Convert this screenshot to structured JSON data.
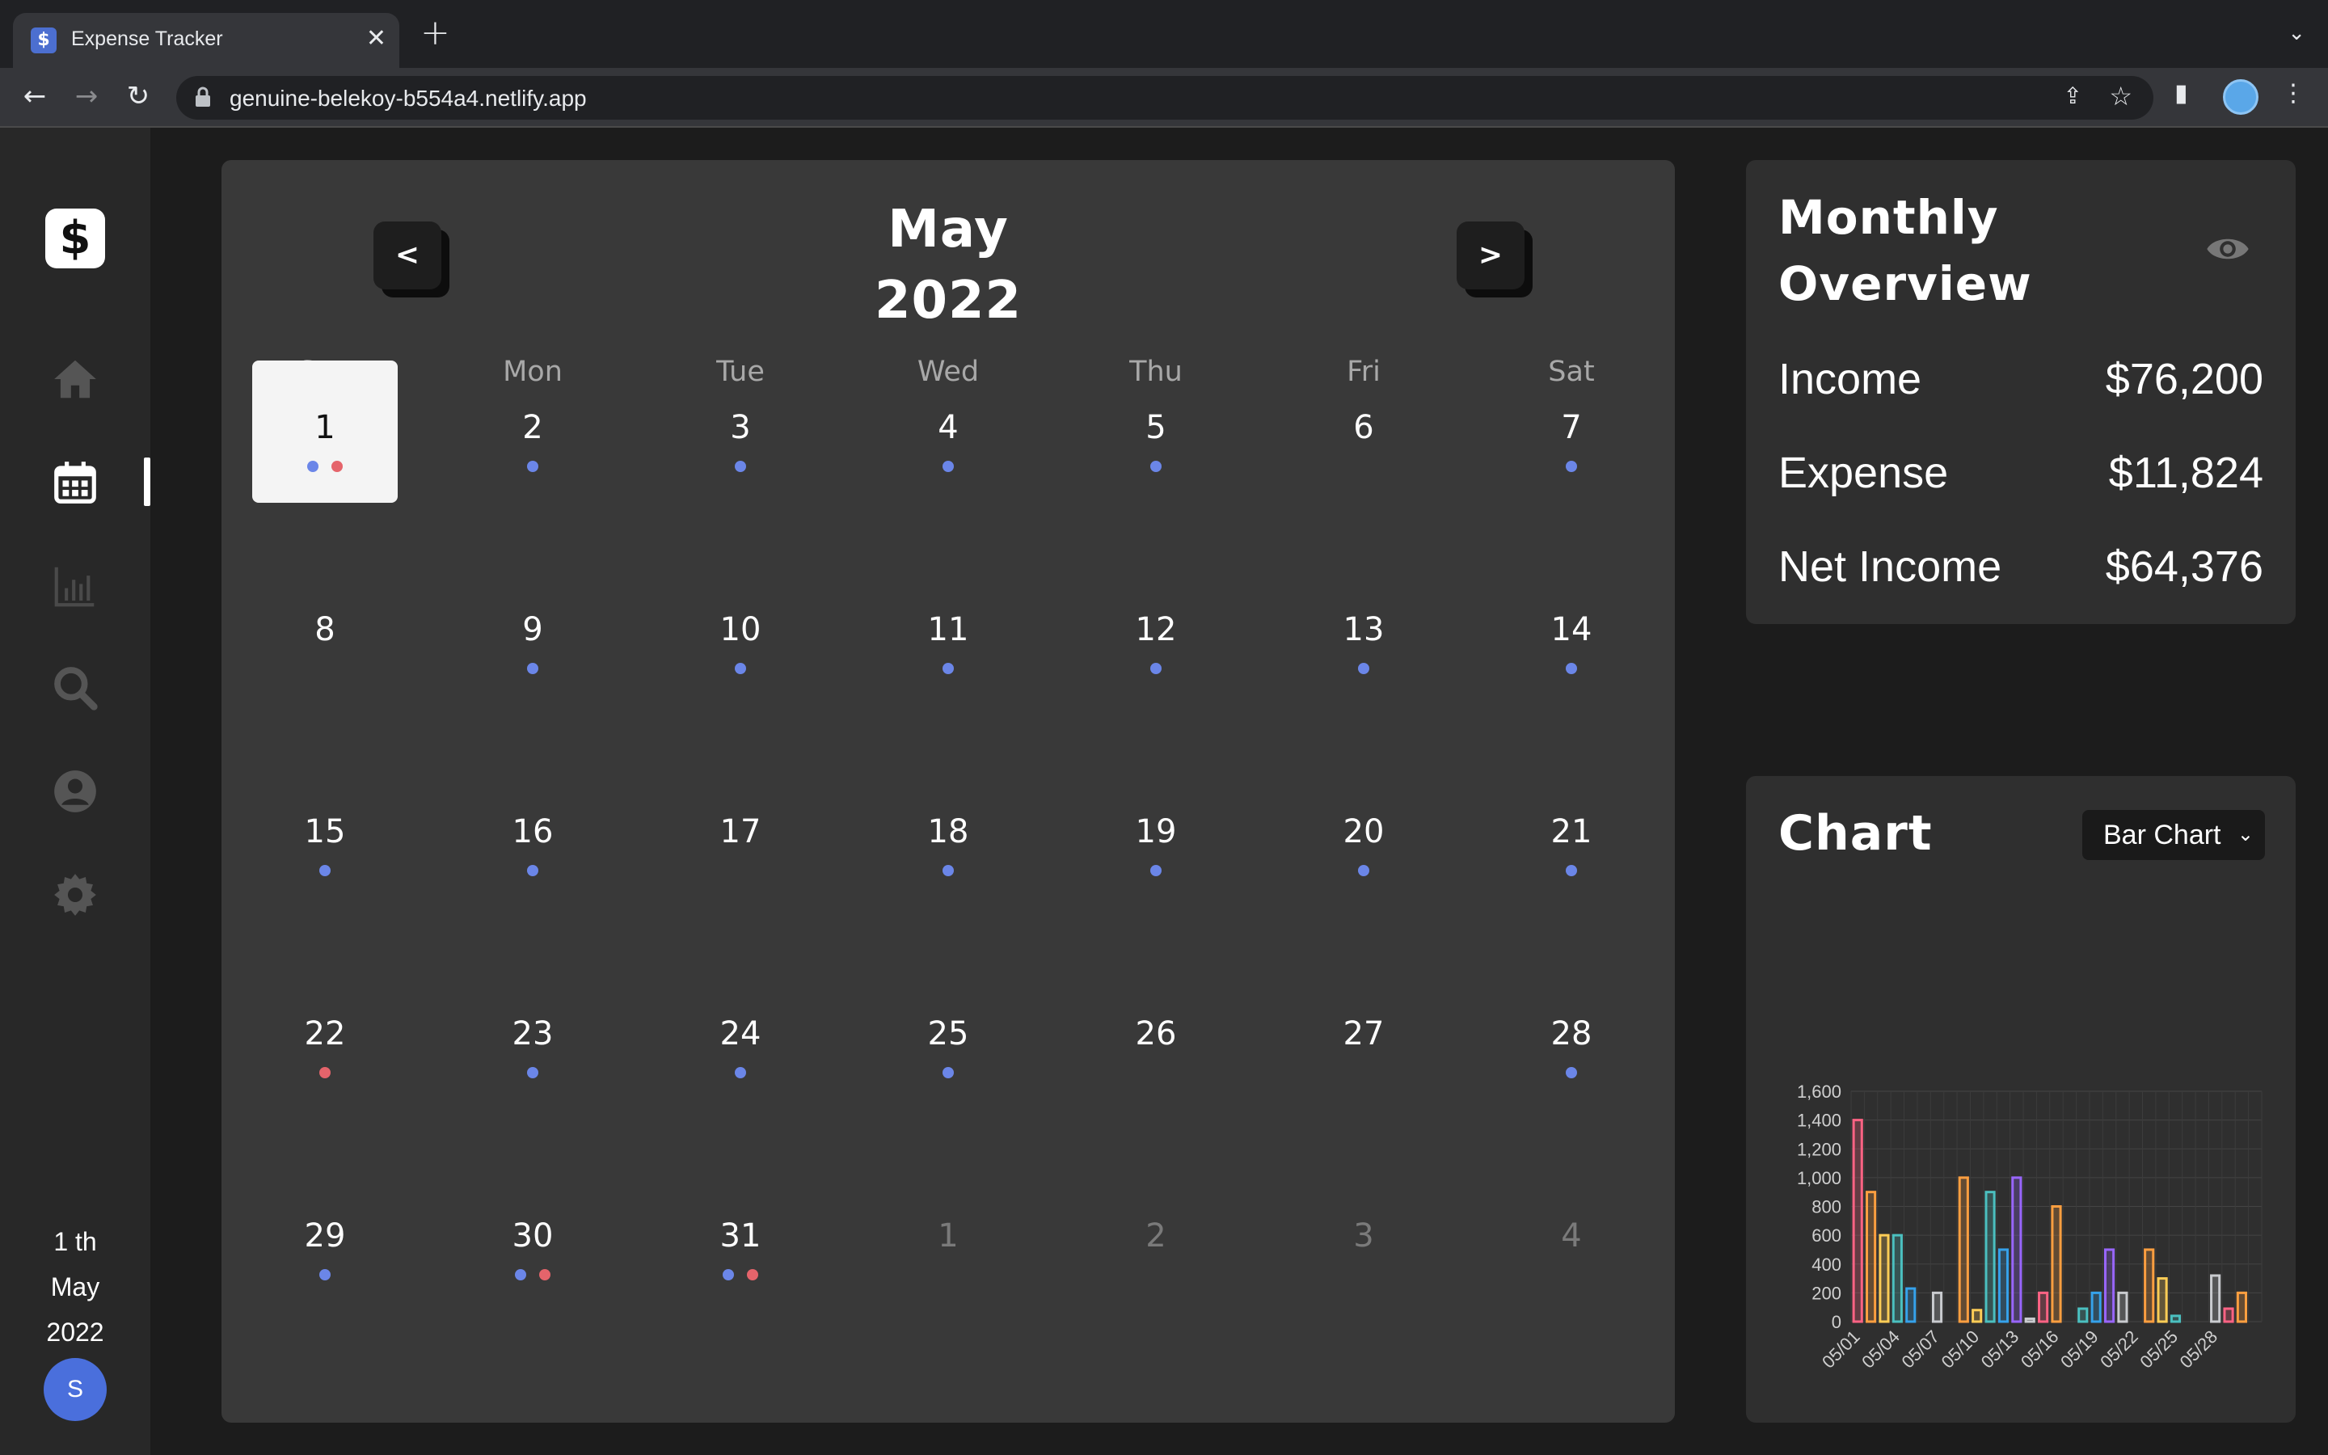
{
  "browser": {
    "tab_title": "Expense Tracker",
    "favicon": "$",
    "url": "genuine-belekoy-b554a4.netlify.app"
  },
  "sidebar": {
    "logo": "$",
    "date_day": "1 th",
    "date_month": "May",
    "date_year": "2022",
    "avatar_initial": "S"
  },
  "calendar": {
    "prev_label": "<",
    "next_label": ">",
    "month": "May",
    "year": "2022",
    "weekdays": [
      "Sun",
      "Mon",
      "Tue",
      "Wed",
      "Thu",
      "Fri",
      "Sat"
    ],
    "days": [
      {
        "n": "1",
        "dots": [
          "income",
          "expense"
        ],
        "selected": true
      },
      {
        "n": "2",
        "dots": [
          "income"
        ]
      },
      {
        "n": "3",
        "dots": [
          "income"
        ]
      },
      {
        "n": "4",
        "dots": [
          "income"
        ]
      },
      {
        "n": "5",
        "dots": [
          "income"
        ]
      },
      {
        "n": "6",
        "dots": []
      },
      {
        "n": "7",
        "dots": [
          "income"
        ]
      },
      {
        "n": "8",
        "dots": []
      },
      {
        "n": "9",
        "dots": [
          "income"
        ]
      },
      {
        "n": "10",
        "dots": [
          "income"
        ]
      },
      {
        "n": "11",
        "dots": [
          "income"
        ]
      },
      {
        "n": "12",
        "dots": [
          "income"
        ]
      },
      {
        "n": "13",
        "dots": [
          "income"
        ]
      },
      {
        "n": "14",
        "dots": [
          "income"
        ]
      },
      {
        "n": "15",
        "dots": [
          "income"
        ]
      },
      {
        "n": "16",
        "dots": [
          "income"
        ]
      },
      {
        "n": "17",
        "dots": []
      },
      {
        "n": "18",
        "dots": [
          "income"
        ]
      },
      {
        "n": "19",
        "dots": [
          "income"
        ]
      },
      {
        "n": "20",
        "dots": [
          "income"
        ]
      },
      {
        "n": "21",
        "dots": [
          "income"
        ]
      },
      {
        "n": "22",
        "dots": [
          "expense"
        ]
      },
      {
        "n": "23",
        "dots": [
          "income"
        ]
      },
      {
        "n": "24",
        "dots": [
          "income"
        ]
      },
      {
        "n": "25",
        "dots": [
          "income"
        ]
      },
      {
        "n": "26",
        "dots": []
      },
      {
        "n": "27",
        "dots": []
      },
      {
        "n": "28",
        "dots": [
          "income"
        ]
      },
      {
        "n": "29",
        "dots": [
          "income"
        ]
      },
      {
        "n": "30",
        "dots": [
          "income",
          "expense"
        ]
      },
      {
        "n": "31",
        "dots": [
          "income",
          "expense"
        ]
      },
      {
        "n": "1",
        "dots": [],
        "other": true
      },
      {
        "n": "2",
        "dots": [],
        "other": true
      },
      {
        "n": "3",
        "dots": [],
        "other": true
      },
      {
        "n": "4",
        "dots": [],
        "other": true
      }
    ]
  },
  "overview": {
    "title_line1": "Monthly",
    "title_line2": "Overview",
    "rows": [
      {
        "label": "Income",
        "value": "$76,200"
      },
      {
        "label": "Expense",
        "value": "$11,824"
      },
      {
        "label": "Net Income",
        "value": "$64,376"
      }
    ]
  },
  "chart_card": {
    "title": "Chart",
    "selected_type": "Bar Chart"
  },
  "colors": {
    "income_dot": "#6b86e8",
    "expense_dot": "#e5646b",
    "accent": "#4a6fdc"
  },
  "chart_data": {
    "type": "bar",
    "categories": [
      "05/01",
      "05/02",
      "05/03",
      "05/04",
      "05/05",
      "05/06",
      "05/07",
      "05/08",
      "05/09",
      "05/10",
      "05/11",
      "05/12",
      "05/13",
      "05/14",
      "05/15",
      "05/16",
      "05/17",
      "05/18",
      "05/19",
      "05/20",
      "05/21",
      "05/22",
      "05/23",
      "05/24",
      "05/25",
      "05/26",
      "05/27",
      "05/28",
      "05/29",
      "05/30",
      "05/31"
    ],
    "tick_labels": [
      "05/01",
      "05/04",
      "05/07",
      "05/10",
      "05/13",
      "05/16",
      "05/19",
      "05/22",
      "05/25",
      "05/28"
    ],
    "values": [
      1400,
      900,
      600,
      600,
      230,
      0,
      200,
      0,
      1000,
      80,
      900,
      500,
      1000,
      20,
      200,
      800,
      0,
      90,
      200,
      500,
      200,
      0,
      500,
      300,
      40,
      0,
      0,
      320,
      90,
      200,
      0
    ],
    "bar_colors": [
      "#ff6384",
      "#ff9f40",
      "#ffcd56",
      "#4bc0c0",
      "#36a2eb",
      "#9966ff",
      "#c9cbcf",
      "#ff6384",
      "#ff9f40",
      "#ffcd56",
      "#4bc0c0",
      "#36a2eb",
      "#9966ff",
      "#c9cbcf",
      "#ff6384",
      "#ff9f40",
      "#ffcd56",
      "#4bc0c0",
      "#36a2eb",
      "#9966ff",
      "#c9cbcf",
      "#ff6384",
      "#ff9f40",
      "#ffcd56",
      "#4bc0c0",
      "#36a2eb",
      "#9966ff",
      "#c9cbcf",
      "#ff6384",
      "#ff9f40",
      "#ffcd56"
    ],
    "yticks": [
      "0",
      "200",
      "400",
      "600",
      "800",
      "1,000",
      "1,200",
      "1,400",
      "1,600"
    ],
    "ylim": [
      0,
      1600
    ],
    "grid": true,
    "legend": "none"
  }
}
